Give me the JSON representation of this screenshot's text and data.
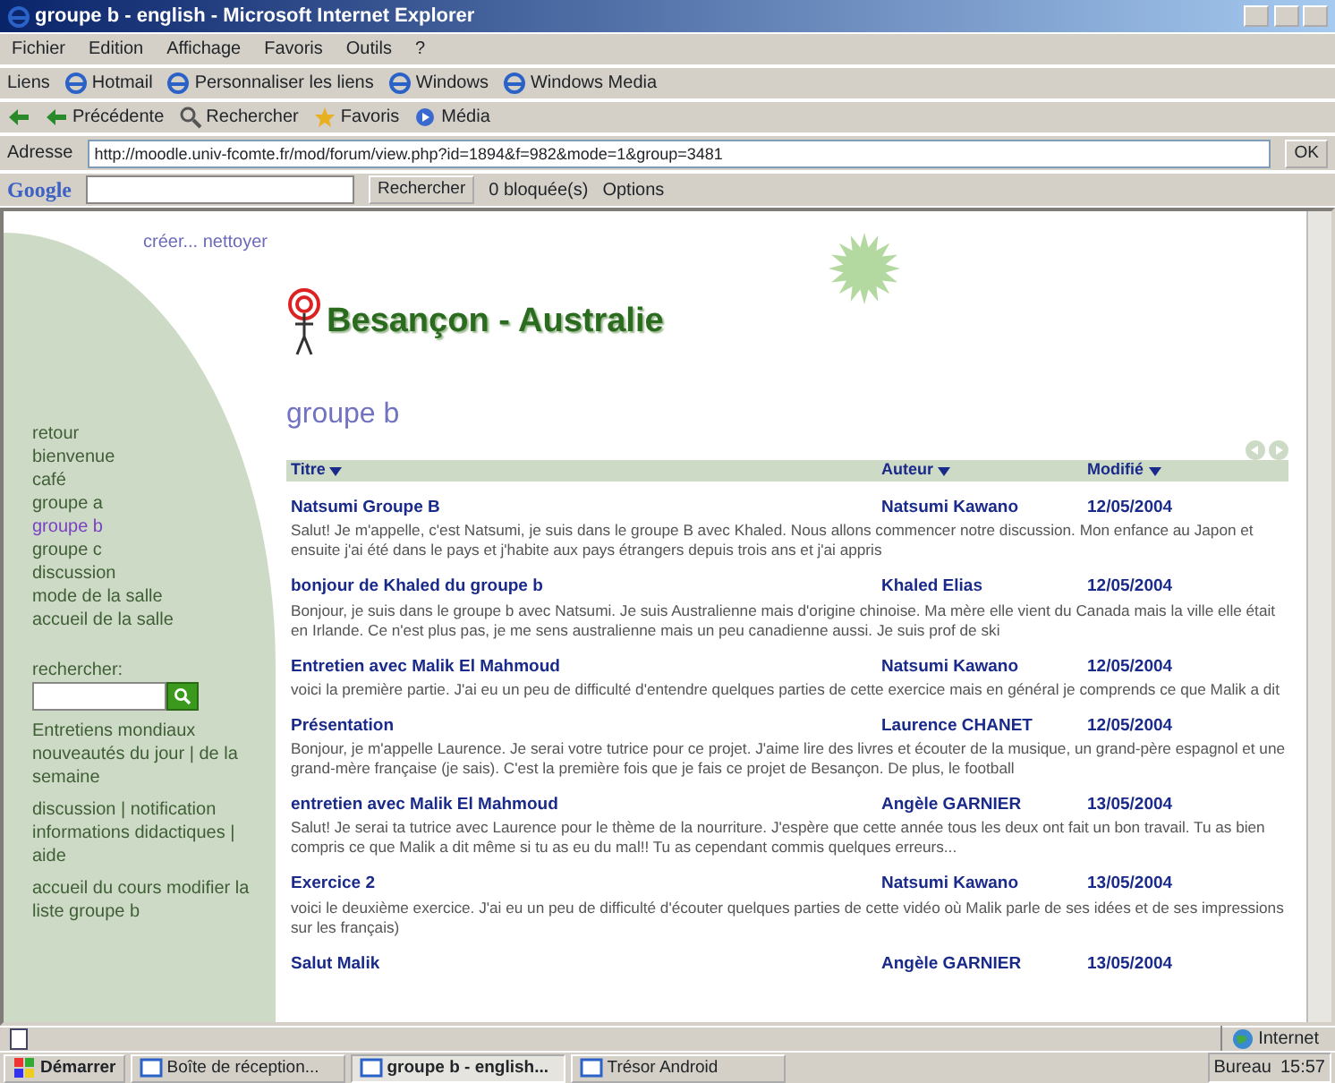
{
  "window": {
    "title": "groupe b - english - Microsoft Internet Explorer"
  },
  "menu": [
    "Fichier",
    "Edition",
    "Affichage",
    "Favoris",
    "Outils",
    "?"
  ],
  "links_bar": {
    "label": "Liens",
    "items": [
      "Hotmail",
      "Personnaliser les liens",
      "Windows",
      "Windows Media"
    ]
  },
  "toolbar": {
    "buttons": [
      "Précédente",
      "Rechercher",
      "Favoris",
      "Média"
    ]
  },
  "address": {
    "label": "Adresse",
    "url": "http://moodle.univ-fcomte.fr/mod/forum/view.php?id=1894&f=982&mode=1&group=3481",
    "go": "OK"
  },
  "google_bar": {
    "logo": "Google",
    "search_button": "Rechercher",
    "blocked": "0 bloquée(s)",
    "options": "Options"
  },
  "page": {
    "top_links": "créer... nettoyer",
    "site_title": "Besançon - Australie",
    "nav": [
      {
        "label": "retour",
        "selected": false
      },
      {
        "label": "bienvenue",
        "selected": false
      },
      {
        "label": "café",
        "selected": false
      },
      {
        "label": "groupe a",
        "selected": false
      },
      {
        "label": "groupe b",
        "selected": true
      },
      {
        "label": "groupe c",
        "selected": false
      },
      {
        "label": "discussion",
        "selected": false
      },
      {
        "label": "mode de la salle",
        "selected": false
      },
      {
        "label": "accueil de la salle",
        "selected": false
      }
    ],
    "search": {
      "label": "rechercher:"
    },
    "side_links": [
      "Entretiens mondiaux nouveautés du jour | de la semaine",
      "discussion | notification informations didactiques | aide",
      "accueil du cours modifier la liste groupe b"
    ],
    "heading": "groupe b",
    "columns": [
      "Titre",
      "Auteur",
      "Modifié"
    ],
    "rows": [
      {
        "title": "Natsumi Groupe B",
        "author": "Natsumi Kawano",
        "date": "12/05/2004",
        "description": "Salut! Je m'appelle, c'est Natsumi, je suis dans le groupe B avec Khaled. Nous allons commencer notre discussion. Mon enfance au Japon et ensuite j'ai été dans le pays et j'habite aux pays étrangers depuis trois ans et j'ai appris"
      },
      {
        "title": "bonjour de Khaled du groupe b",
        "author": "Khaled Elias",
        "date": "12/05/2004",
        "description": "Bonjour, je suis dans le groupe b avec Natsumi. Je suis Australienne mais d'origine chinoise. Ma mère elle vient du Canada mais la ville elle était en Irlande. Ce n'est plus pas, je me sens australienne mais un peu canadienne aussi. Je suis prof de ski"
      },
      {
        "title": "Entretien avec Malik El Mahmoud",
        "author": "Natsumi Kawano",
        "date": "12/05/2004",
        "description": "voici la première partie. J'ai eu un peu de difficulté d'entendre quelques parties de cette exercice mais en général je comprends ce que Malik a dit"
      },
      {
        "title": "Présentation",
        "author": "Laurence CHANET",
        "date": "12/05/2004",
        "description": "Bonjour, je m'appelle Laurence. Je serai votre tutrice pour ce projet. J'aime lire des livres et écouter de la musique, un grand-père espagnol et une grand-mère française (je sais). C'est la première fois que je fais ce projet de Besançon. De plus, le football"
      },
      {
        "title": "entretien avec Malik El Mahmoud",
        "author": "Angèle GARNIER",
        "date": "13/05/2004",
        "description": "Salut! Je serai ta tutrice avec Laurence pour le thème de la nourriture. J'espère que cette année tous les deux ont fait un bon travail. Tu as bien compris ce que Malik a dit même si tu as eu du mal!! Tu as cependant commis quelques erreurs..."
      },
      {
        "title": "Exercice 2",
        "author": "Natsumi Kawano",
        "date": "13/05/2004",
        "description": "voici le deuxième exercice. J'ai eu un peu de difficulté d'écouter quelques parties de cette vidéo où Malik parle de ses idées et de ses impressions sur les français)"
      },
      {
        "title": "Salut Malik",
        "author": "Angèle GARNIER",
        "date": "13/05/2004",
        "description": ""
      }
    ]
  },
  "status_bar": {
    "zone": "Internet"
  },
  "taskbar": {
    "start": "Démarrer",
    "tasks": [
      {
        "label": "Boîte de réception...",
        "active": false
      },
      {
        "label": "groupe b - english...",
        "active": true
      },
      {
        "label": "Trésor Android",
        "active": false
      }
    ],
    "tray_label": "Bureau",
    "clock": "15:57"
  }
}
